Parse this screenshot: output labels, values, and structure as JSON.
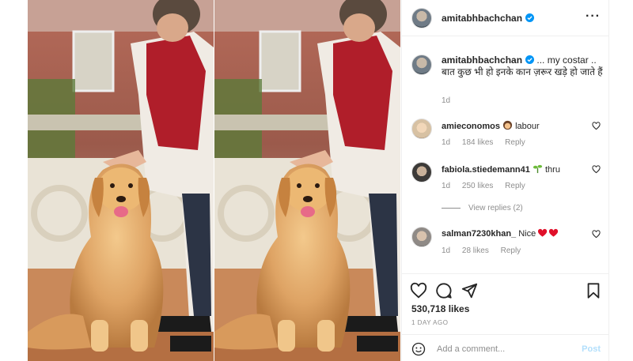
{
  "post": {
    "username": "amitabhbachchan",
    "more_icon": "more-horizontal-icon",
    "caption": {
      "username": "amitabhbachchan",
      "text": " ... my costar .. बात कुछ भी हो इनके कान ज़रूर खड़े हो जाते हैं",
      "time": "1d"
    }
  },
  "comments": [
    {
      "username": "amieconomos",
      "text": " labour",
      "emoji": "woman-emoji",
      "time": "1d",
      "likes": "184 likes",
      "reply": "Reply"
    },
    {
      "username": "fabiola.stiedemann41",
      "text": " thru",
      "emoji": "plant-emoji",
      "time": "1d",
      "likes": "250 likes",
      "reply": "Reply"
    },
    {
      "username": "salman7230khan_",
      "text": " Nice",
      "emoji": "red-hearts-emoji",
      "time": "1d",
      "likes": "28 likes",
      "reply": "Reply"
    }
  ],
  "view_replies": "View replies (2)",
  "footer": {
    "likes": "530,718 likes",
    "date": "1 DAY AGO",
    "comment_placeholder": "Add a comment...",
    "post_label": "Post"
  },
  "colors": {
    "accent": "#0095f6",
    "post_disabled": "#b2dffc",
    "secondary_text": "#8e8e8e",
    "heart_red": "#ed4956"
  }
}
